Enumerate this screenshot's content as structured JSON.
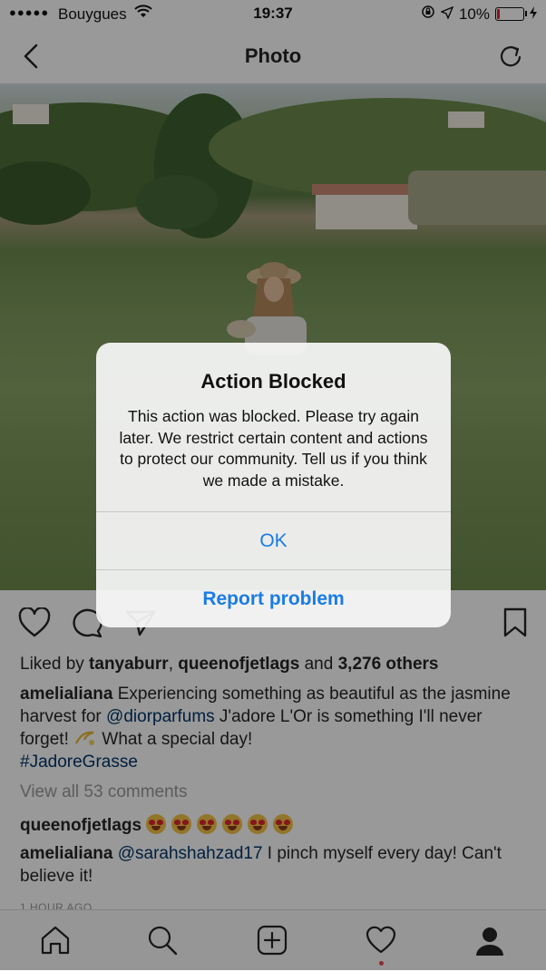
{
  "status_bar": {
    "signal": "●●●●●",
    "carrier": "Bouygues",
    "time": "19:37",
    "battery": "10%",
    "battery_level": 0.1
  },
  "nav": {
    "title": "Photo"
  },
  "post": {
    "liked_by_prefix": "Liked by ",
    "liked_user_1": "tanyaburr",
    "separator": ", ",
    "liked_user_2": "queenofjetlags",
    "liked_and": " and ",
    "liked_others": "3,276 others",
    "caption_user": "amelialiana",
    "caption_part1": " Experiencing something as beautiful as the jasmine harvest for ",
    "caption_mention": "@diorparfums",
    "caption_part2": " J'adore L'Or is something I'll never forget! ",
    "caption_part3": " What a special day! ",
    "caption_hashtag": "#JadoreGrasse",
    "view_all": "View all 53 comments",
    "comments": [
      {
        "user": "queenofjetlags"
      },
      {
        "user": "amelialiana",
        "mention": "@sarahshahzad17",
        "text": " I pinch myself every day! Can't believe it!"
      }
    ],
    "time_ago": "1 HOUR AGO"
  },
  "alert": {
    "title": "Action Blocked",
    "message": "This action was blocked. Please try again later. We restrict certain content and actions to protect our community. Tell us if you think we made a mistake.",
    "ok_label": "OK",
    "report_label": "Report problem"
  },
  "icons": {
    "back": "chevron-left-icon",
    "refresh": "refresh-icon",
    "like": "heart-icon",
    "comment": "comment-icon",
    "share": "share-icon",
    "save": "bookmark-icon",
    "home": "home-icon",
    "search": "search-icon",
    "add": "add-post-icon",
    "activity": "activity-heart-icon",
    "profile": "profile-icon"
  },
  "colors": {
    "link": "#003569",
    "alert_button": "#1a7ce6",
    "battery_low": "#e0262d",
    "notification_dot": "#ed4956"
  }
}
